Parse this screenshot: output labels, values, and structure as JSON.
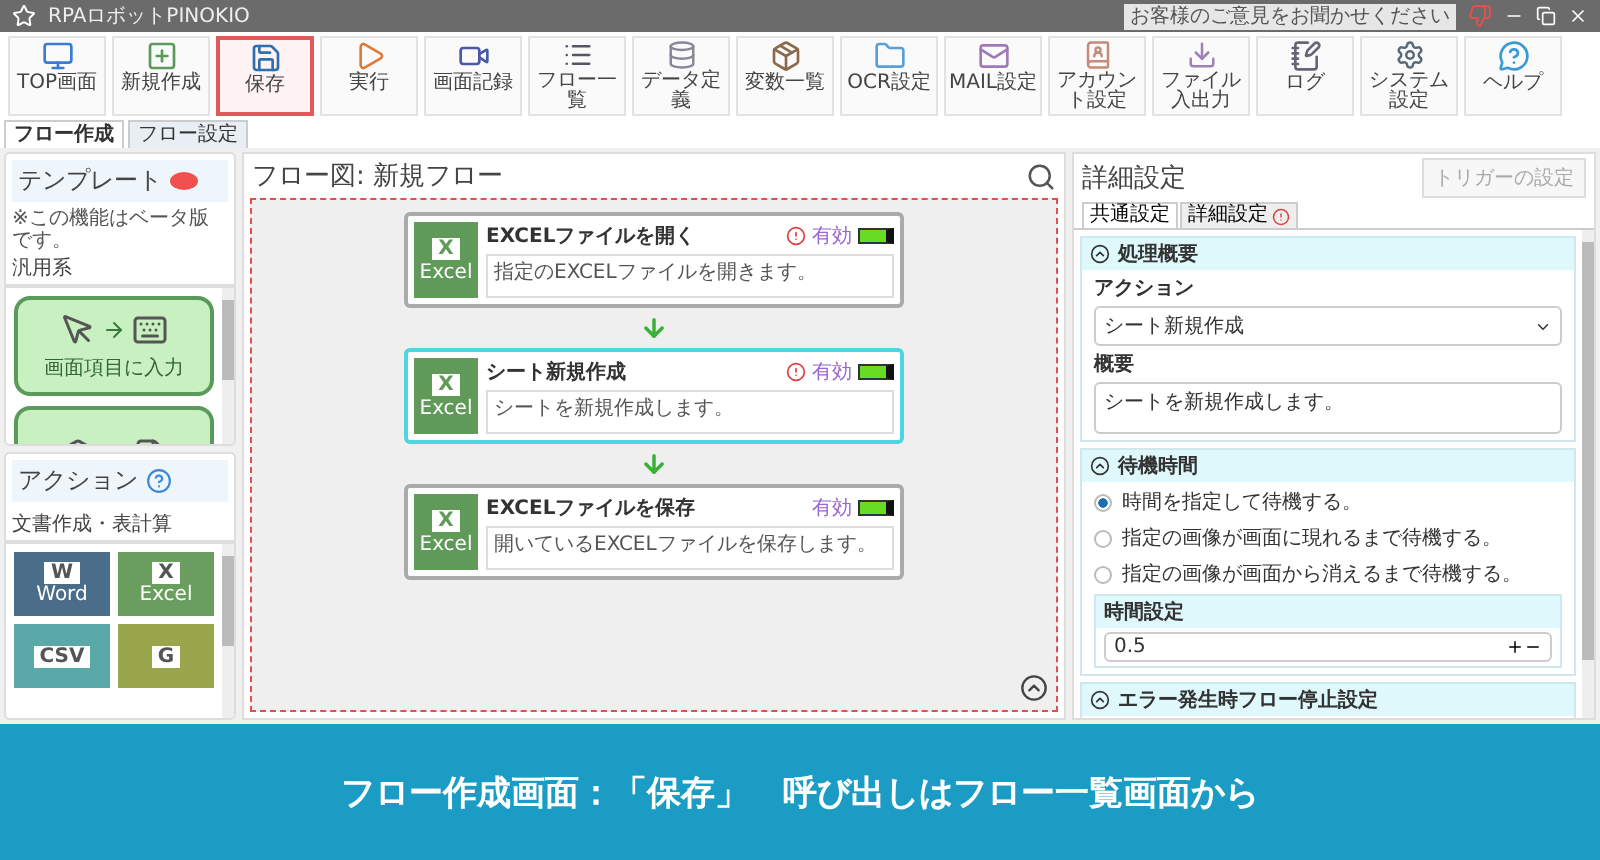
{
  "window": {
    "title": "RPAロボットPINOKIO",
    "feedback": "お客様のご意見をお聞かせください"
  },
  "toolbar": [
    {
      "label": "TOP画面",
      "kind": "top",
      "highlighted": false
    },
    {
      "label": "新規作成",
      "kind": "new",
      "highlighted": false
    },
    {
      "label": "保存",
      "kind": "save",
      "highlighted": true
    },
    {
      "label": "実行",
      "kind": "run",
      "highlighted": false
    },
    {
      "label": "画面記録",
      "kind": "record",
      "highlighted": false
    },
    {
      "label": "フロー一覧",
      "kind": "list",
      "highlighted": false
    },
    {
      "label": "データ定義",
      "kind": "data",
      "highlighted": false
    },
    {
      "label": "変数一覧",
      "kind": "vars",
      "highlighted": false
    },
    {
      "label": "OCR設定",
      "kind": "ocr",
      "highlighted": false
    },
    {
      "label": "MAIL設定",
      "kind": "mail",
      "highlighted": false
    },
    {
      "label": "アカウント設定",
      "kind": "account",
      "highlighted": false
    },
    {
      "label": "ファイル入出力",
      "kind": "file",
      "highlighted": false
    },
    {
      "label": "ログ",
      "kind": "log",
      "highlighted": false
    },
    {
      "label": "システム設定",
      "kind": "system",
      "highlighted": false
    },
    {
      "label": "ヘルプ",
      "kind": "help",
      "highlighted": false
    }
  ],
  "view_tabs": [
    {
      "label": "フロー作成",
      "selected": true
    },
    {
      "label": "フロー設定",
      "selected": false
    }
  ],
  "templates": {
    "title": "テンプレート",
    "note": "※この機能はベータ版です。",
    "category": "汎用系",
    "cards": [
      {
        "label": "画面項目に入力",
        "kind": "input"
      },
      {
        "kind": "report"
      }
    ]
  },
  "actions": {
    "title": "アクション",
    "category": "文書作成・表計算",
    "tiles": [
      {
        "letter": "W",
        "name": "Word",
        "color": "#4a6e8a"
      },
      {
        "letter": "X",
        "name": "Excel",
        "color": "#6a9e5f"
      },
      {
        "letter": "CSV",
        "color": "#5aa8a8"
      },
      {
        "letter": "G",
        "color": "#9aa64c"
      }
    ]
  },
  "flow": {
    "title": "フロー図: 新規フロー",
    "steps": [
      {
        "title": "EXCELファイルを開く",
        "description": "指定のEXCELファイルを開きます。",
        "letter": "X",
        "app": "Excel",
        "warning": true,
        "enabled_label": "有効",
        "enabled": true,
        "selected": false
      },
      {
        "title": "シート新規作成",
        "description": "シートを新規作成します。",
        "letter": "X",
        "app": "Excel",
        "warning": true,
        "enabled_label": "有効",
        "enabled": true,
        "selected": true
      },
      {
        "title": "EXCELファイルを保存",
        "description": "開いているEXCELファイルを保存します。",
        "letter": "X",
        "app": "Excel",
        "warning": false,
        "enabled_label": "有効",
        "enabled": true,
        "selected": false
      }
    ]
  },
  "details": {
    "title": "詳細設定",
    "trigger_button": {
      "label": "トリガーの設定",
      "disabled": true
    },
    "tabs": [
      {
        "label": "共通設定",
        "selected": true,
        "warning": false
      },
      {
        "label": "詳細設定",
        "selected": false,
        "warning": true
      }
    ],
    "summary": {
      "title": "処理概要",
      "action_label": "アクション",
      "action_value": "シート新規作成",
      "overview_label": "概要",
      "overview_value": "シートを新規作成します。"
    },
    "wait": {
      "title": "待機時間",
      "options": [
        {
          "label": "時間を指定して待機する。",
          "selected": true
        },
        {
          "label": "指定の画像が画面に現れるまで待機する。",
          "selected": false
        },
        {
          "label": "指定の画像が画面から消えるまで待機する。",
          "selected": false
        }
      ],
      "time_label": "時間設定",
      "time_value": "0.5"
    },
    "error_section": {
      "title": "エラー発生時フロー停止設定"
    }
  },
  "caption": "フロー作成画面：「保存」　呼び出しはフロー一覧画面から"
}
